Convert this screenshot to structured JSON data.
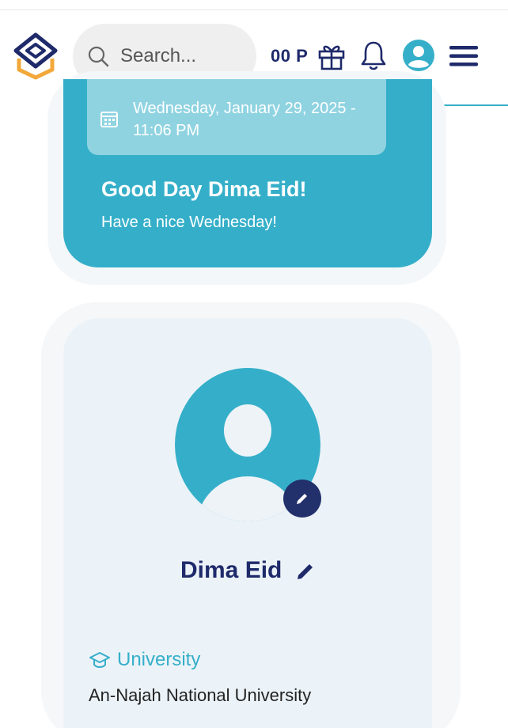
{
  "header": {
    "search_placeholder": "Search...",
    "points": "00 P"
  },
  "greeting": {
    "date_line1": "Wednesday, January 29, 2025 -",
    "date_line2": "11:06 PM",
    "hello": "Good Day Dima Eid!",
    "subtitle": "Have a nice Wednesday!"
  },
  "profile": {
    "name": "Dima Eid",
    "university_label": "University",
    "university_value": "An-Najah National University"
  },
  "colors": {
    "brand_teal": "#35afc9",
    "navy": "#1f2a6b",
    "logo_orange": "#f2a83a"
  },
  "icons": [
    "logo-icon",
    "search-icon",
    "gift-icon",
    "bell-icon",
    "user-circle-icon",
    "menu-icon",
    "calendar-icon",
    "pencil-icon",
    "graduation-cap-icon"
  ]
}
